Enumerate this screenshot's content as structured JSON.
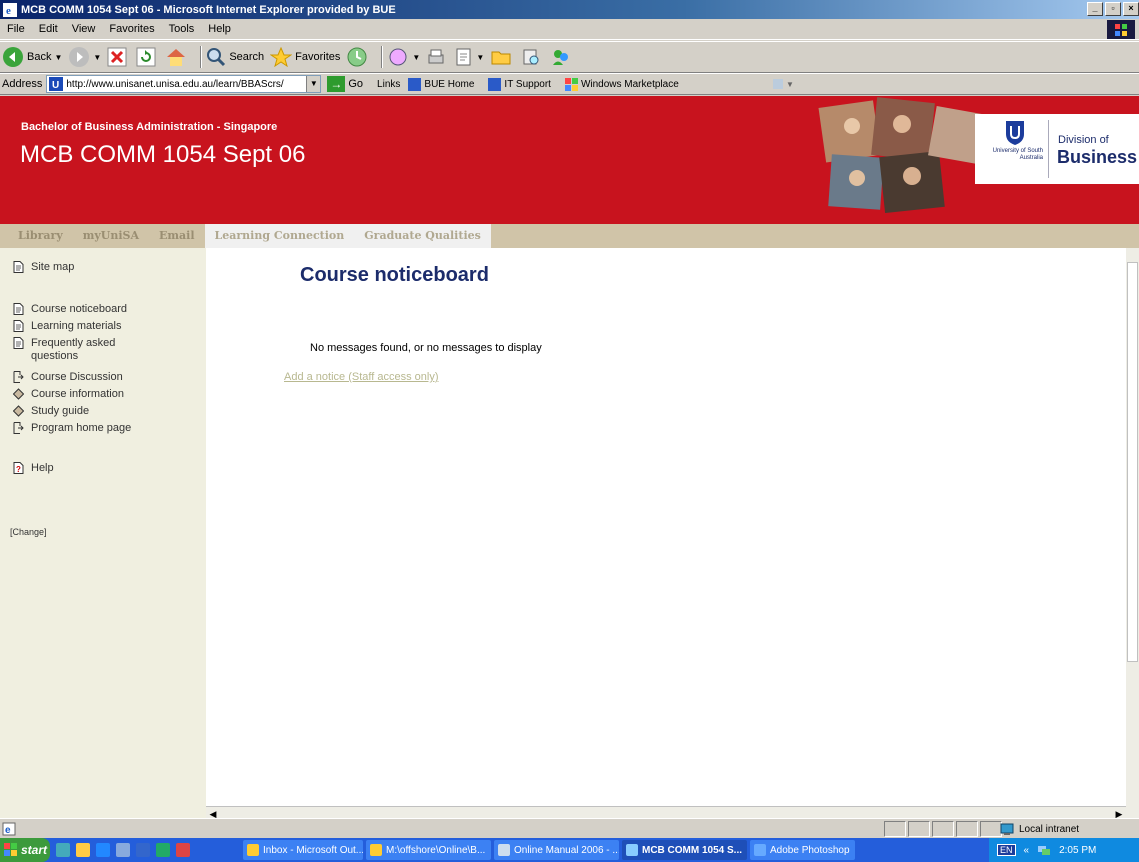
{
  "window": {
    "title": "MCB COMM 1054 Sept 06 - Microsoft Internet Explorer provided by BUE"
  },
  "menu": [
    "File",
    "Edit",
    "View",
    "Favorites",
    "Tools",
    "Help"
  ],
  "toolbar": {
    "back": "Back",
    "search": "Search",
    "favorites": "Favorites"
  },
  "address": {
    "label": "Address",
    "url": "http://www.unisanet.unisa.edu.au/learn/BBAScrs/",
    "go": "Go",
    "links_label": "Links",
    "links": [
      "BUE Home",
      "IT Support",
      "Windows Marketplace"
    ]
  },
  "banner": {
    "program": "Bachelor of Business Administration - Singapore",
    "course": "MCB COMM 1054 Sept 06",
    "university": "University of South Australia",
    "division_line1": "Division of",
    "division_line2": "Business"
  },
  "nav": [
    "Library",
    "myUniSA",
    "Email",
    "Learning Connection",
    "Graduate Qualities"
  ],
  "sidebar": {
    "items": [
      {
        "label": "Site map"
      },
      {
        "label": "Course noticeboard"
      },
      {
        "label": "Learning materials"
      },
      {
        "label": "Frequently asked questions"
      },
      {
        "label": "Course Discussion"
      },
      {
        "label": "Course information"
      },
      {
        "label": "Study guide"
      },
      {
        "label": "Program home page"
      },
      {
        "label": "Help"
      }
    ],
    "change": "[Change]"
  },
  "content": {
    "heading": "Course noticeboard",
    "message": "No messages found, or no messages to display",
    "add_link": "Add a notice (Staff access only)"
  },
  "status": {
    "zone": "Local intranet"
  },
  "taskbar": {
    "start": "start",
    "tasks": [
      "Inbox - Microsoft Out...",
      "M:\\offshore\\Online\\B...",
      "Online Manual 2006 - ...",
      "MCB COMM 1054 S...",
      "Adobe Photoshop"
    ],
    "lang": "EN",
    "clock": "2:05 PM"
  },
  "colors": {
    "banner_red": "#c8131e",
    "heading_navy": "#1c2c6b",
    "sidebar_bg": "#f0efe0",
    "nav_bg": "#d0c4a8"
  }
}
